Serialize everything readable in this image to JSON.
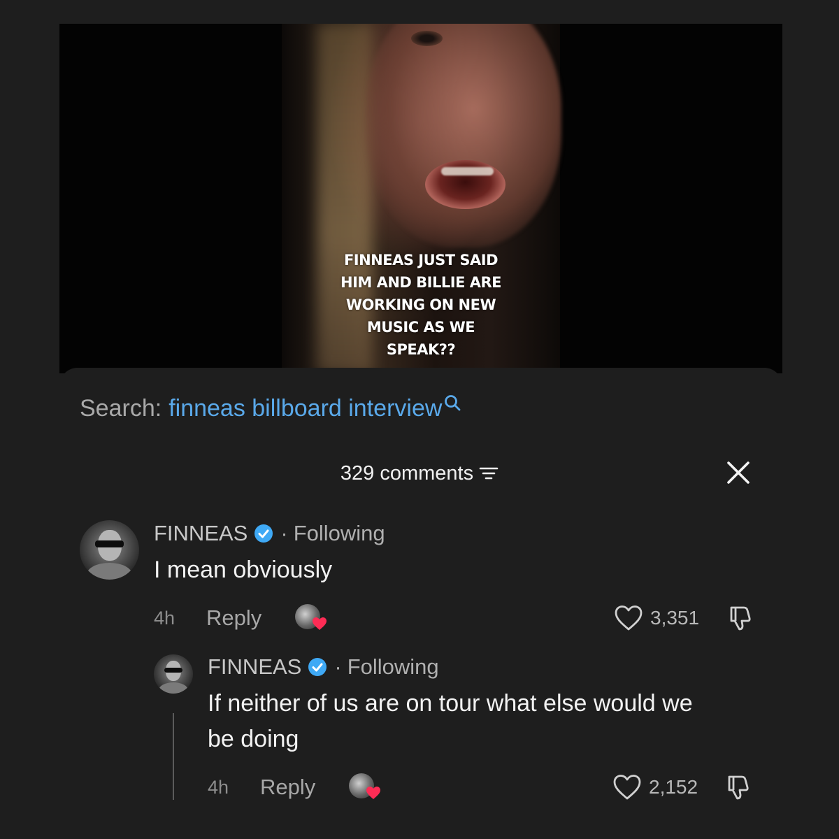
{
  "video": {
    "caption": "FINNEAS JUST SAID\nHIM AND BILLIE ARE\nWORKING ON NEW\nMUSIC AS WE\nSPEAK??"
  },
  "search": {
    "prefix": "Search:",
    "query": "finneas billboard interview",
    "icon": "search-icon"
  },
  "comments_header": {
    "count_label": "329 comments",
    "filter_icon": "filter-icon",
    "close_icon": "close-icon"
  },
  "colors": {
    "background": "#1e1e1e",
    "search_link": "#5aa9ea",
    "verified": "#3fa9f5",
    "like_heart_badge": "#fe2c55"
  },
  "comments": [
    {
      "username": "FINNEAS",
      "verified": true,
      "separator": "·",
      "following": "Following",
      "text": "I mean obviously",
      "time": "4h",
      "reply_label": "Reply",
      "likes": "3,351"
    },
    {
      "username": "FINNEAS",
      "verified": true,
      "separator": "·",
      "following": "Following",
      "text": "If neither of us are on tour what else would we\nbe doing",
      "time": "4h",
      "reply_label": "Reply",
      "likes": "2,152"
    }
  ]
}
